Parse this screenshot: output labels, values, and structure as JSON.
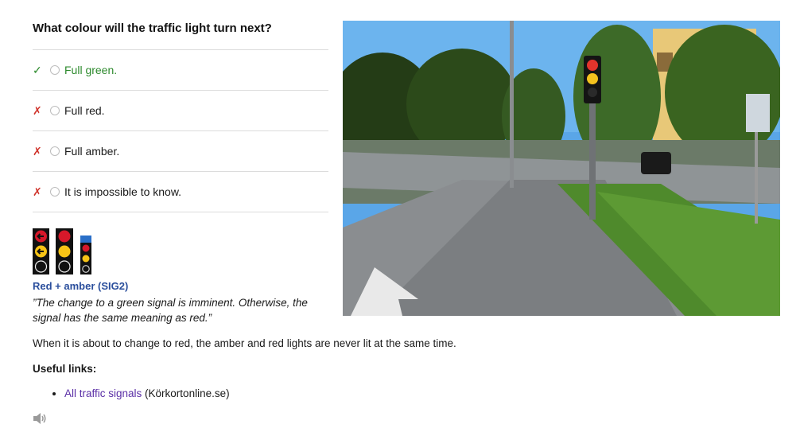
{
  "question": "What colour will the traffic light turn next?",
  "answers": [
    {
      "text": "Full green.",
      "mark": "✓",
      "correct": true
    },
    {
      "text": "Full red.",
      "mark": "✗",
      "correct": false
    },
    {
      "text": "Full amber.",
      "mark": "✗",
      "correct": false
    },
    {
      "text": "It is impossible to know.",
      "mark": "✗",
      "correct": false
    }
  ],
  "signal": {
    "label": "Red + amber (SIG2)",
    "quote": "”The change to a green signal is imminent. Otherwise, the signal has the same meaning as red.”"
  },
  "note": "When it is about to change to red, the amber and red lights are never lit at the same time.",
  "useful_links": {
    "title": "Useful links:",
    "items": [
      {
        "link_text": "All traffic signals",
        "source": " (Körkortonline.se)"
      }
    ]
  },
  "icons": {
    "speaker": "speaker-icon",
    "correct": "check-icon",
    "wrong": "cross-icon"
  },
  "colors": {
    "correct": "#2d8a2d",
    "wrong": "#d0342c",
    "link": "#5a2ea6",
    "signal_label": "#2a4e9c"
  }
}
